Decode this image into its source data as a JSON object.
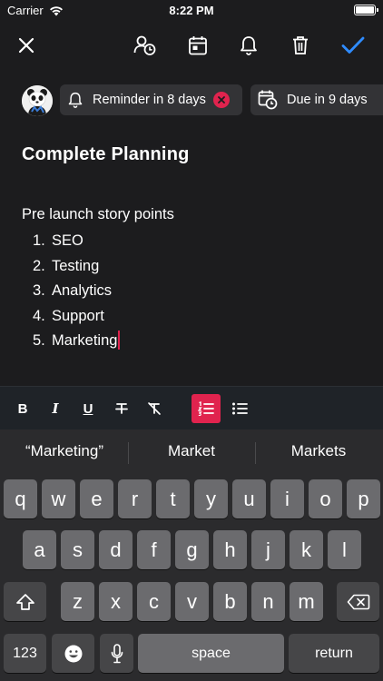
{
  "status_bar": {
    "carrier": "Carrier",
    "time": "8:22 PM"
  },
  "toolbar": {
    "icons": [
      "close-icon",
      "assign-user-icon",
      "calendar-icon",
      "bell-icon",
      "trash-icon",
      "checkmark-icon"
    ],
    "accent": "#2f8cff"
  },
  "chips": {
    "reminder_label": "Reminder in 8 days",
    "due_label": "Due in 9 days",
    "remove_color": "#e0234e"
  },
  "note": {
    "title": "Complete Planning",
    "intro": "Pre launch story points",
    "items": [
      {
        "num": "1.",
        "text": "SEO"
      },
      {
        "num": "2.",
        "text": "Testing"
      },
      {
        "num": "3.",
        "text": "Analytics"
      },
      {
        "num": "4.",
        "text": "Support"
      },
      {
        "num": "5.",
        "text": "Marketing"
      }
    ]
  },
  "format_bar": {
    "bold": "B",
    "italic": "I",
    "underline": "U",
    "active_color": "#e0234e",
    "active_tool": "numbered-list"
  },
  "keyboard": {
    "suggestions": [
      "“Marketing”",
      "Market",
      "Markets"
    ],
    "row1": [
      "q",
      "w",
      "e",
      "r",
      "t",
      "y",
      "u",
      "i",
      "o",
      "p"
    ],
    "row2": [
      "a",
      "s",
      "d",
      "f",
      "g",
      "h",
      "j",
      "k",
      "l"
    ],
    "row3": [
      "z",
      "x",
      "c",
      "v",
      "b",
      "n",
      "m"
    ],
    "numbers_label": "123",
    "space_label": "space",
    "return_label": "return"
  }
}
